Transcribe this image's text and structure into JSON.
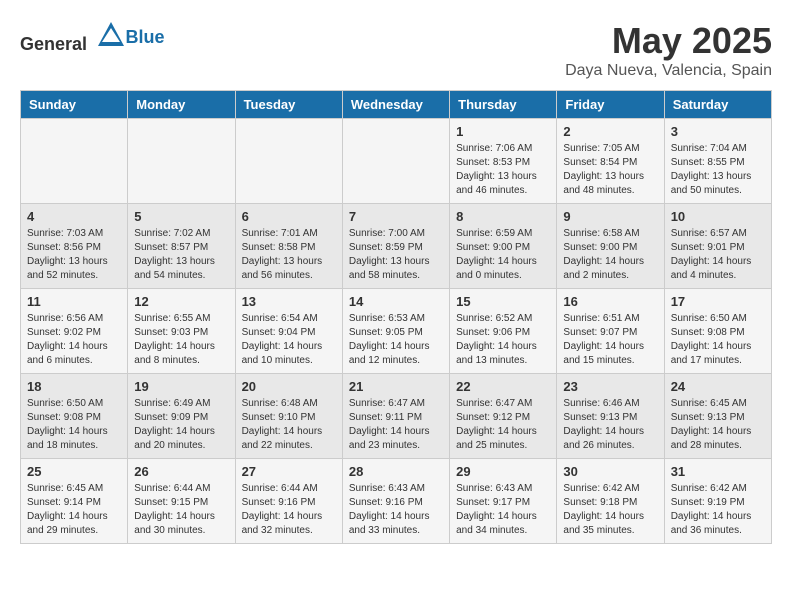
{
  "header": {
    "logo_general": "General",
    "logo_blue": "Blue",
    "month": "May 2025",
    "location": "Daya Nueva, Valencia, Spain"
  },
  "calendar": {
    "days_of_week": [
      "Sunday",
      "Monday",
      "Tuesday",
      "Wednesday",
      "Thursday",
      "Friday",
      "Saturday"
    ],
    "weeks": [
      [
        {
          "day": "",
          "sunrise": "",
          "sunset": "",
          "daylight": ""
        },
        {
          "day": "",
          "sunrise": "",
          "sunset": "",
          "daylight": ""
        },
        {
          "day": "",
          "sunrise": "",
          "sunset": "",
          "daylight": ""
        },
        {
          "day": "",
          "sunrise": "",
          "sunset": "",
          "daylight": ""
        },
        {
          "day": "1",
          "sunrise": "Sunrise: 7:06 AM",
          "sunset": "Sunset: 8:53 PM",
          "daylight": "Daylight: 13 hours and 46 minutes."
        },
        {
          "day": "2",
          "sunrise": "Sunrise: 7:05 AM",
          "sunset": "Sunset: 8:54 PM",
          "daylight": "Daylight: 13 hours and 48 minutes."
        },
        {
          "day": "3",
          "sunrise": "Sunrise: 7:04 AM",
          "sunset": "Sunset: 8:55 PM",
          "daylight": "Daylight: 13 hours and 50 minutes."
        }
      ],
      [
        {
          "day": "4",
          "sunrise": "Sunrise: 7:03 AM",
          "sunset": "Sunset: 8:56 PM",
          "daylight": "Daylight: 13 hours and 52 minutes."
        },
        {
          "day": "5",
          "sunrise": "Sunrise: 7:02 AM",
          "sunset": "Sunset: 8:57 PM",
          "daylight": "Daylight: 13 hours and 54 minutes."
        },
        {
          "day": "6",
          "sunrise": "Sunrise: 7:01 AM",
          "sunset": "Sunset: 8:58 PM",
          "daylight": "Daylight: 13 hours and 56 minutes."
        },
        {
          "day": "7",
          "sunrise": "Sunrise: 7:00 AM",
          "sunset": "Sunset: 8:59 PM",
          "daylight": "Daylight: 13 hours and 58 minutes."
        },
        {
          "day": "8",
          "sunrise": "Sunrise: 6:59 AM",
          "sunset": "Sunset: 9:00 PM",
          "daylight": "Daylight: 14 hours and 0 minutes."
        },
        {
          "day": "9",
          "sunrise": "Sunrise: 6:58 AM",
          "sunset": "Sunset: 9:00 PM",
          "daylight": "Daylight: 14 hours and 2 minutes."
        },
        {
          "day": "10",
          "sunrise": "Sunrise: 6:57 AM",
          "sunset": "Sunset: 9:01 PM",
          "daylight": "Daylight: 14 hours and 4 minutes."
        }
      ],
      [
        {
          "day": "11",
          "sunrise": "Sunrise: 6:56 AM",
          "sunset": "Sunset: 9:02 PM",
          "daylight": "Daylight: 14 hours and 6 minutes."
        },
        {
          "day": "12",
          "sunrise": "Sunrise: 6:55 AM",
          "sunset": "Sunset: 9:03 PM",
          "daylight": "Daylight: 14 hours and 8 minutes."
        },
        {
          "day": "13",
          "sunrise": "Sunrise: 6:54 AM",
          "sunset": "Sunset: 9:04 PM",
          "daylight": "Daylight: 14 hours and 10 minutes."
        },
        {
          "day": "14",
          "sunrise": "Sunrise: 6:53 AM",
          "sunset": "Sunset: 9:05 PM",
          "daylight": "Daylight: 14 hours and 12 minutes."
        },
        {
          "day": "15",
          "sunrise": "Sunrise: 6:52 AM",
          "sunset": "Sunset: 9:06 PM",
          "daylight": "Daylight: 14 hours and 13 minutes."
        },
        {
          "day": "16",
          "sunrise": "Sunrise: 6:51 AM",
          "sunset": "Sunset: 9:07 PM",
          "daylight": "Daylight: 14 hours and 15 minutes."
        },
        {
          "day": "17",
          "sunrise": "Sunrise: 6:50 AM",
          "sunset": "Sunset: 9:08 PM",
          "daylight": "Daylight: 14 hours and 17 minutes."
        }
      ],
      [
        {
          "day": "18",
          "sunrise": "Sunrise: 6:50 AM",
          "sunset": "Sunset: 9:08 PM",
          "daylight": "Daylight: 14 hours and 18 minutes."
        },
        {
          "day": "19",
          "sunrise": "Sunrise: 6:49 AM",
          "sunset": "Sunset: 9:09 PM",
          "daylight": "Daylight: 14 hours and 20 minutes."
        },
        {
          "day": "20",
          "sunrise": "Sunrise: 6:48 AM",
          "sunset": "Sunset: 9:10 PM",
          "daylight": "Daylight: 14 hours and 22 minutes."
        },
        {
          "day": "21",
          "sunrise": "Sunrise: 6:47 AM",
          "sunset": "Sunset: 9:11 PM",
          "daylight": "Daylight: 14 hours and 23 minutes."
        },
        {
          "day": "22",
          "sunrise": "Sunrise: 6:47 AM",
          "sunset": "Sunset: 9:12 PM",
          "daylight": "Daylight: 14 hours and 25 minutes."
        },
        {
          "day": "23",
          "sunrise": "Sunrise: 6:46 AM",
          "sunset": "Sunset: 9:13 PM",
          "daylight": "Daylight: 14 hours and 26 minutes."
        },
        {
          "day": "24",
          "sunrise": "Sunrise: 6:45 AM",
          "sunset": "Sunset: 9:13 PM",
          "daylight": "Daylight: 14 hours and 28 minutes."
        }
      ],
      [
        {
          "day": "25",
          "sunrise": "Sunrise: 6:45 AM",
          "sunset": "Sunset: 9:14 PM",
          "daylight": "Daylight: 14 hours and 29 minutes."
        },
        {
          "day": "26",
          "sunrise": "Sunrise: 6:44 AM",
          "sunset": "Sunset: 9:15 PM",
          "daylight": "Daylight: 14 hours and 30 minutes."
        },
        {
          "day": "27",
          "sunrise": "Sunrise: 6:44 AM",
          "sunset": "Sunset: 9:16 PM",
          "daylight": "Daylight: 14 hours and 32 minutes."
        },
        {
          "day": "28",
          "sunrise": "Sunrise: 6:43 AM",
          "sunset": "Sunset: 9:16 PM",
          "daylight": "Daylight: 14 hours and 33 minutes."
        },
        {
          "day": "29",
          "sunrise": "Sunrise: 6:43 AM",
          "sunset": "Sunset: 9:17 PM",
          "daylight": "Daylight: 14 hours and 34 minutes."
        },
        {
          "day": "30",
          "sunrise": "Sunrise: 6:42 AM",
          "sunset": "Sunset: 9:18 PM",
          "daylight": "Daylight: 14 hours and 35 minutes."
        },
        {
          "day": "31",
          "sunrise": "Sunrise: 6:42 AM",
          "sunset": "Sunset: 9:19 PM",
          "daylight": "Daylight: 14 hours and 36 minutes."
        }
      ]
    ]
  }
}
